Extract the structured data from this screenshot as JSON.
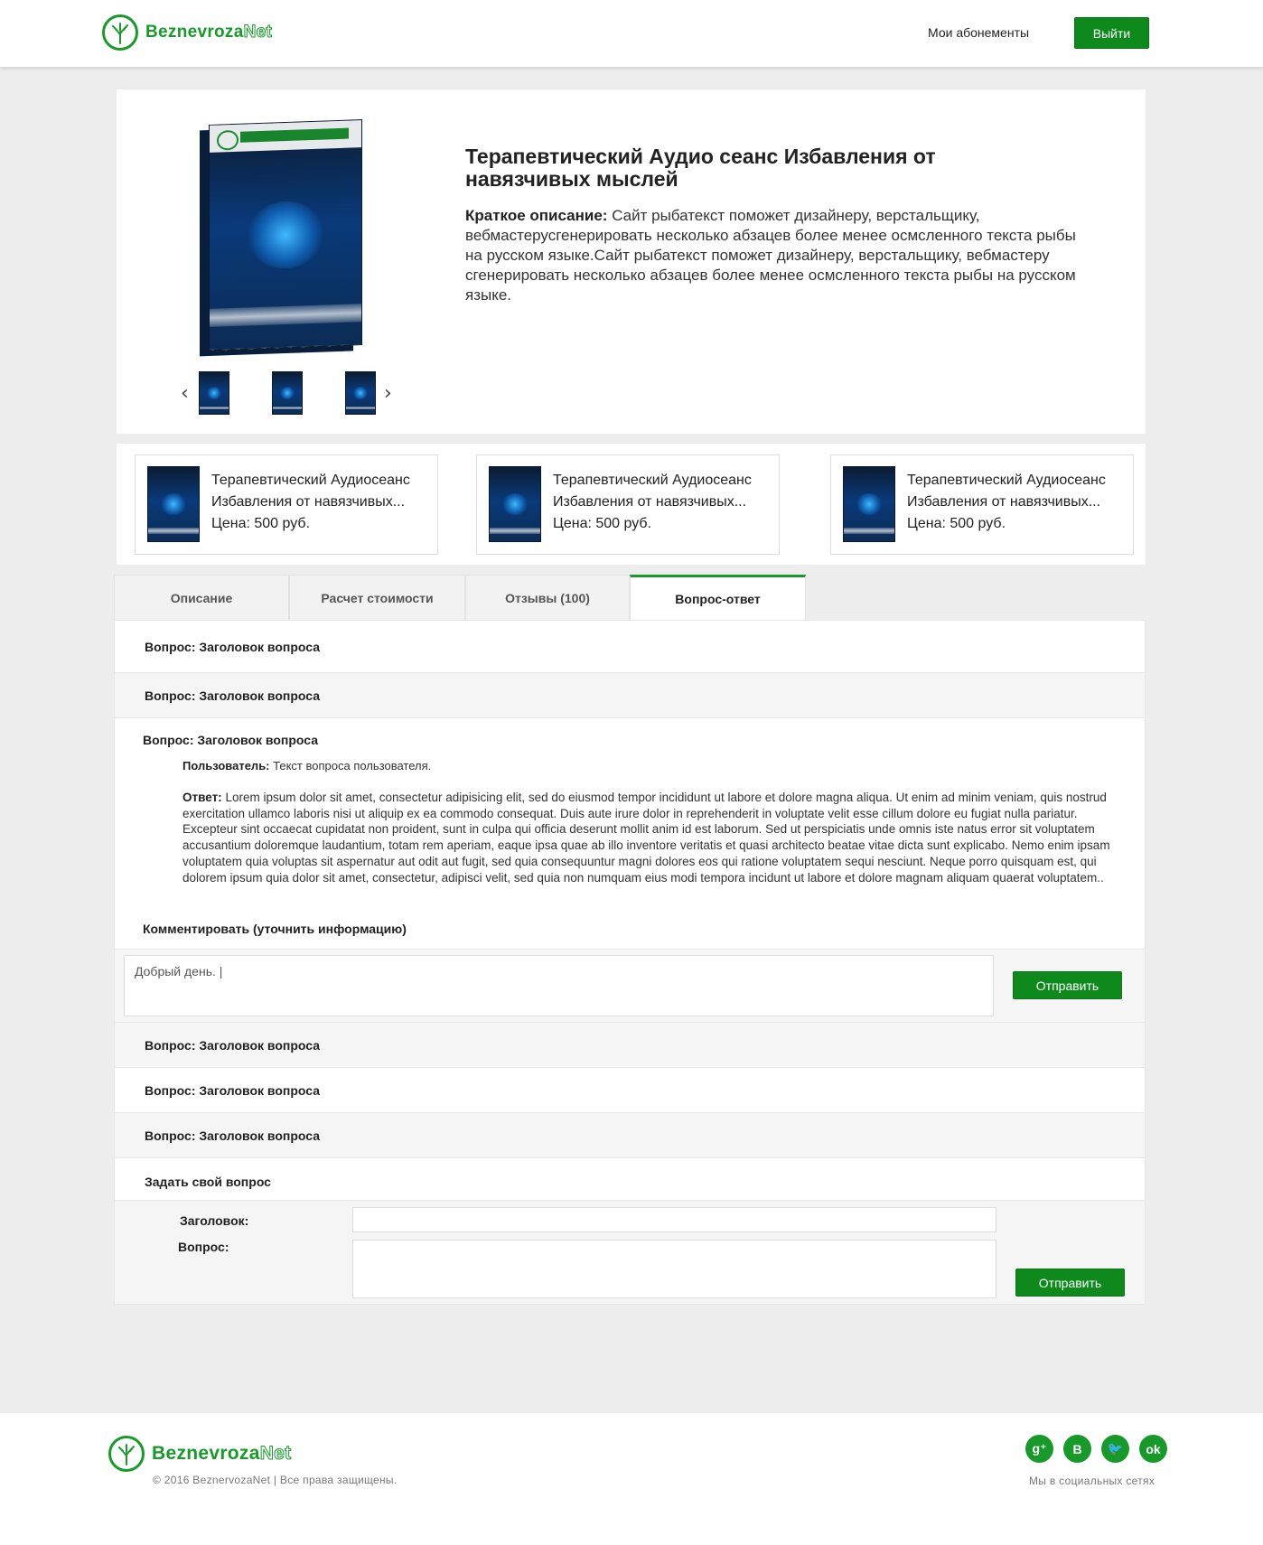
{
  "header": {
    "logo": {
      "brand_part1": "Beznevroza",
      "brand_part2": "Net"
    },
    "nav_subscriptions": "Мои абонементы",
    "logout_label": "Выйти"
  },
  "product": {
    "title": "Терапевтический Аудио сеанс Избавления от навязчивых мыслей",
    "short_desc_label": "Краткое описание:",
    "short_desc_text": "Сайт рыбатекст поможет дизайнеру,  верстальщику, вебмастерусгенерировать несколько абзацев более  менее осмсленного текста рыбы на русском языке.Сайт рыбатекст поможет дизайнеру, верстальщику, вебмастеру сгенерировать несколько абзацев более менее осмсленного текста рыбы на русском языке.",
    "gallery": {
      "prev_icon": "‹",
      "next_icon": "›"
    }
  },
  "related": [
    {
      "line1": "Терапевтический Аудиосеанс",
      "line2": "Избавления от навязчивых...",
      "price": "Цена: 500 руб."
    },
    {
      "line1": "Терапевтический Аудиосеанс",
      "line2": "Избавления от навязчивых...",
      "price": "Цена: 500 руб."
    },
    {
      "line1": "Терапевтический Аудиосеанс",
      "line2": "Избавления от навязчивых...",
      "price": "Цена: 500 руб."
    }
  ],
  "tabs": [
    {
      "label": "Описание",
      "active": false
    },
    {
      "label": "Расчет стоимости",
      "active": false
    },
    {
      "label": "Отзывы (100)",
      "active": false
    },
    {
      "label": "Вопрос-ответ",
      "active": true
    }
  ],
  "qa": {
    "questions_top": [
      "Вопрос: Заголовок вопроса",
      "Вопрос: Заголовок вопроса"
    ],
    "open": {
      "title": "Вопрос: Заголовок вопроса",
      "user_label": "Пользователь:",
      "user_text": "Текст вопроса пользователя.",
      "answer_label": "Ответ:",
      "answer_text": "Lorem ipsum dolor sit amet, consectetur adipisicing elit, sed do eiusmod tempor incididunt ut labore et dolore magna aliqua. Ut enim ad minim veniam, quis nostrud exercitation ullamco laboris nisi ut aliquip ex ea commodo consequat. Duis aute irure dolor in reprehenderit in voluptate velit esse cillum dolore eu fugiat nulla pariatur. Excepteur sint occaecat cupidatat non proident, sunt in culpa qui officia deserunt mollit anim id est laborum. Sed ut perspiciatis unde omnis  iste natus error sit voluptatem accusantium doloremque laudantium, totam rem aperiam, eaque ipsa quae ab illo inventore veritatis et quasi architecto beatae vitae dicta sunt explicabo. Nemo enim ipsam voluptatem quia voluptas sit aspernatur aut odit aut fugit, sed quia consequuntur magni dolores eos qui ratione voluptatem sequi nesciunt. Neque porro quisquam est, qui dolorem ipsum quia dolor sit amet, consectetur, adipisci velit, sed quia non numquam eius modi tempora incidunt ut labore et dolore magnam aliquam quaerat voluptatem..",
      "comment_label": "Комментировать (уточнить информацию)",
      "comment_value": "Добрый день. |",
      "send_label": "Отправить"
    },
    "questions_bottom": [
      "Вопрос: Заголовок вопроса",
      "Вопрос: Заголовок вопроса",
      "Вопрос: Заголовок вопроса"
    ],
    "ask": {
      "heading": "Задать свой вопрос",
      "title_label": "Заголовок:",
      "question_label": "Вопрос:",
      "send_label": "Отправить"
    }
  },
  "footer": {
    "logo": {
      "brand_part1": "Beznevroza",
      "brand_part2": "Net"
    },
    "copyright": "© 2016 BeznervozaNet | Все права защищены.",
    "socials": [
      {
        "icon": "google-plus-icon",
        "glyph": "g⁺"
      },
      {
        "icon": "vk-icon",
        "glyph": "B"
      },
      {
        "icon": "twitter-icon",
        "glyph": "🐦"
      },
      {
        "icon": "odnoklassniki-icon",
        "glyph": "ok"
      }
    ],
    "socials_label": "Мы в социальных сетях"
  },
  "colors": {
    "brand_green": "#179a2a",
    "button_green": "#0e8a1c",
    "page_bg": "#ededed"
  }
}
